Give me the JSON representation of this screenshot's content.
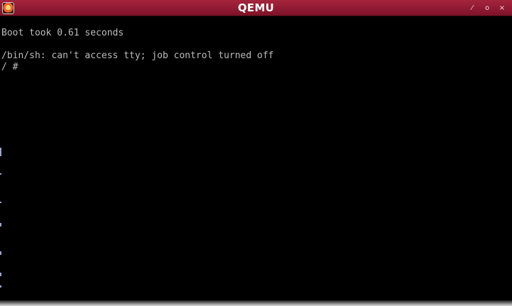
{
  "window": {
    "title": "QEMU",
    "controls": {
      "minimize_glyph": "⁄",
      "maximize_glyph": "o",
      "close_glyph": "×"
    },
    "icon": "qemu-app-icon"
  },
  "console": {
    "lines": [
      "Boot took 0.61 seconds",
      "",
      "/bin/sh: can't access tty; job control turned off",
      "/ #"
    ]
  },
  "colors": {
    "titlebar": "#8e1a31",
    "title_text": "#ffffff",
    "console_background": "#000000",
    "console_text": "#bcbcbc"
  }
}
